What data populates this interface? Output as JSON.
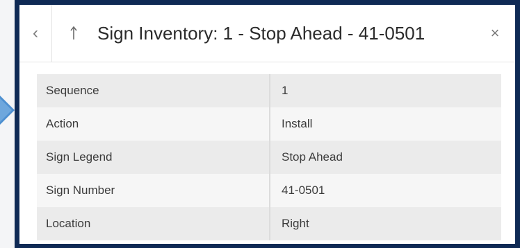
{
  "header": {
    "prev_icon": "chevron-left-icon",
    "up_icon": "arrow-up-icon",
    "title": "Sign Inventory: 1 - Stop Ahead - 41-0501",
    "close_icon": "close-icon"
  },
  "attributes": [
    {
      "field": "Sequence",
      "value": "1"
    },
    {
      "field": "Action",
      "value": "Install"
    },
    {
      "field": "Sign Legend",
      "value": "Stop Ahead"
    },
    {
      "field": "Sign Number",
      "value": "41-0501"
    },
    {
      "field": "Location",
      "value": "Right"
    }
  ],
  "colors": {
    "frame": "#0f2a55",
    "pointer": "#4d8fd0",
    "row_odd": "#ebebeb",
    "row_even": "#f6f6f6"
  }
}
